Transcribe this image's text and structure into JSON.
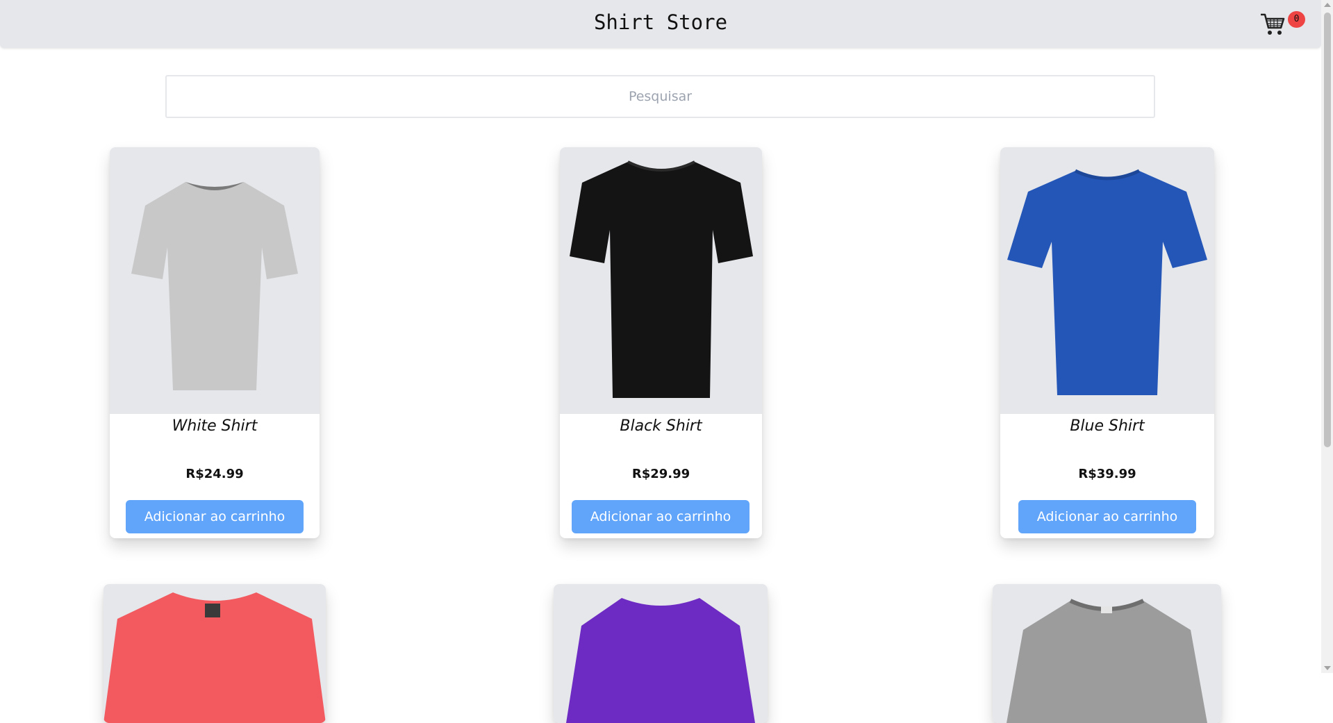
{
  "header": {
    "title": "Shirt Store",
    "cart_count": "0"
  },
  "search": {
    "placeholder": "Pesquisar"
  },
  "products": [
    {
      "name": "White Shirt",
      "price": "R$24.99",
      "button": "Adicionar ao carrinho",
      "color": "#c8c8c8"
    },
    {
      "name": "Black Shirt",
      "price": "R$29.99",
      "button": "Adicionar ao carrinho",
      "color": "#141414"
    },
    {
      "name": "Blue Shirt",
      "price": "R$39.99",
      "button": "Adicionar ao carrinho",
      "color": "#2456b8"
    },
    {
      "color": "#f25a5f"
    },
    {
      "color": "#6e2bc4"
    },
    {
      "color": "#9c9c9c"
    }
  ]
}
